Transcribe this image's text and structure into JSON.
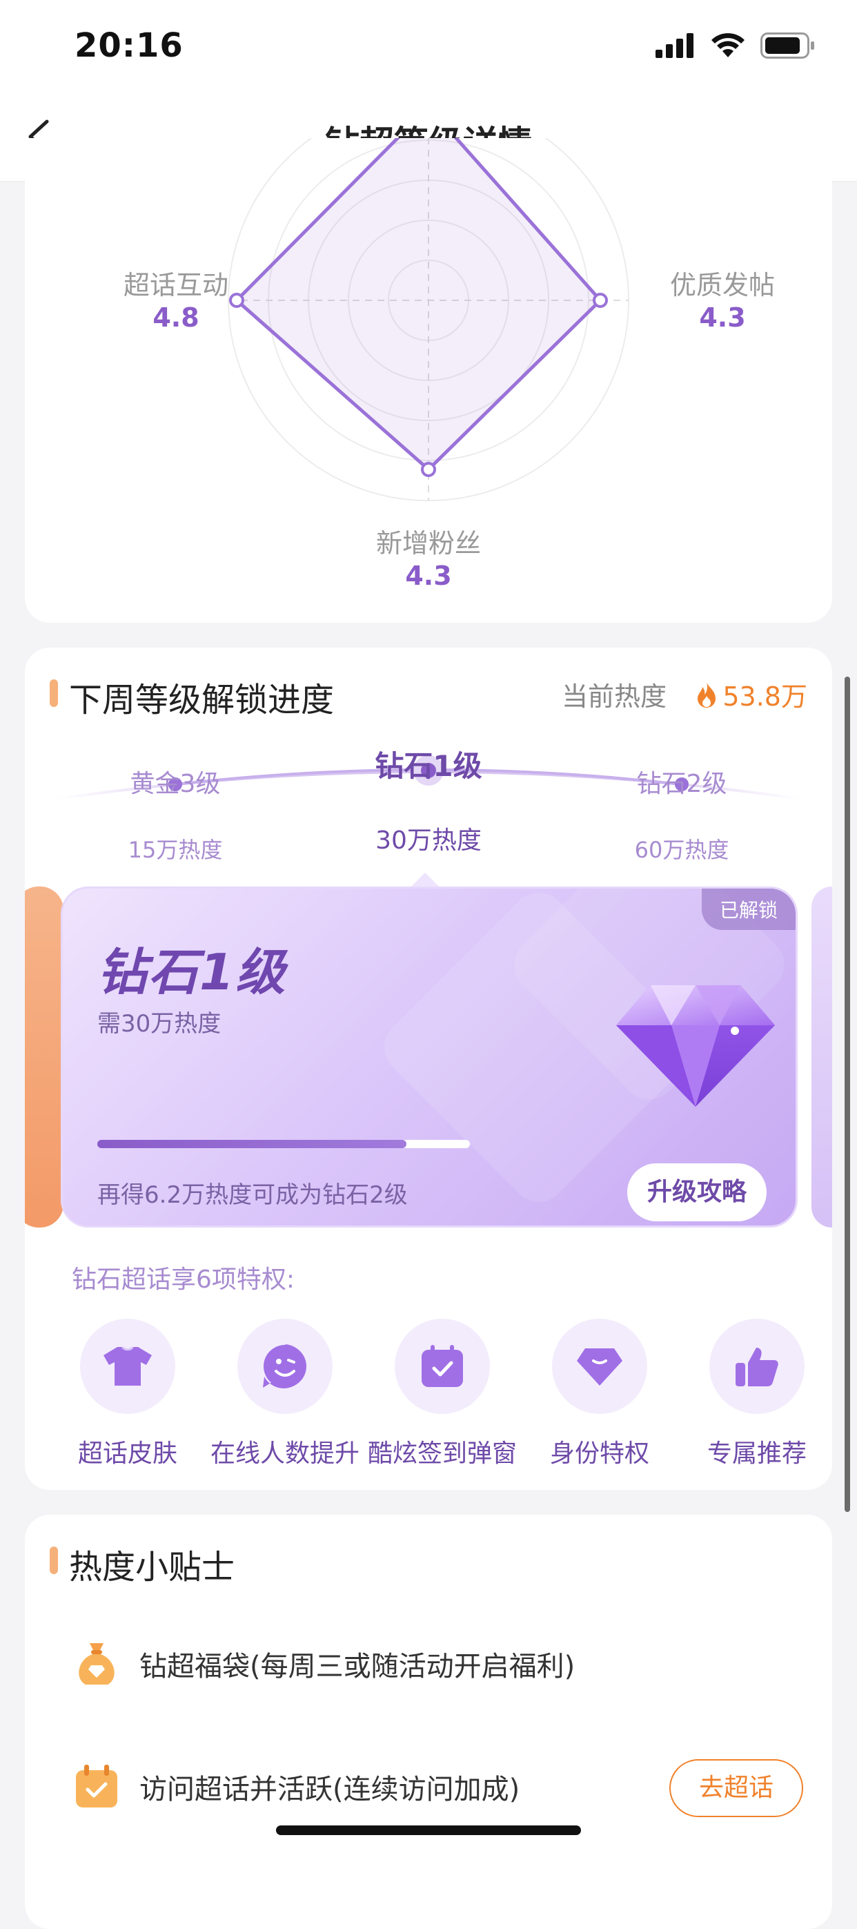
{
  "status_bar": {
    "time": "20:16",
    "icons": [
      "signal-icon",
      "wifi-icon",
      "battery-icon"
    ]
  },
  "nav": {
    "title": "钻超等级详情",
    "back_icon": "chevron-left-icon"
  },
  "radar": {
    "axes": [
      {
        "label": "超话互动",
        "value": "4.8"
      },
      {
        "label": "优质发帖",
        "value": "4.3"
      },
      {
        "label": "新增粉丝",
        "value": "4.3"
      }
    ],
    "accent": "#8a5cc9"
  },
  "progress": {
    "title": "下周等级解锁进度",
    "heat_label": "当前热度",
    "heat_value": "53.8万",
    "levels": [
      {
        "name": "黄金3级",
        "heat": "15万热度"
      },
      {
        "name": "钻石1级",
        "heat": "30万热度"
      },
      {
        "name": "钻石2级",
        "heat": "60万热度"
      }
    ],
    "card": {
      "badge": "已解锁",
      "title": "钻石1级",
      "subtitle": "需30万热度",
      "progress_fraction": 0.83,
      "note": "再得6.2万热度可成为钻石2级",
      "button": "升级攻略"
    },
    "privileges_title": "钻石超话享6项特权:",
    "privileges": [
      {
        "label": "超话皮肤",
        "icon": "tshirt-icon"
      },
      {
        "label": "在线人数提升",
        "icon": "smiley-icon"
      },
      {
        "label": "酷炫签到弹窗",
        "icon": "calendar-check-icon"
      },
      {
        "label": "身份特权",
        "icon": "diamond-icon"
      },
      {
        "label": "专属推荐",
        "icon": "thumbs-up-icon"
      }
    ]
  },
  "tips": {
    "title": "热度小贴士",
    "items": [
      {
        "text": "钻超福袋(每周三或随活动开启福利)",
        "icon": "lucky-bag-icon"
      },
      {
        "text": "访问超话并活跃(连续访问加成)",
        "icon": "calendar-check-icon",
        "button": "去超话"
      }
    ]
  },
  "colors": {
    "accent_purple": "#8a5cc9",
    "accent_orange": "#f0822c",
    "section_bar": "#f6b07a"
  }
}
